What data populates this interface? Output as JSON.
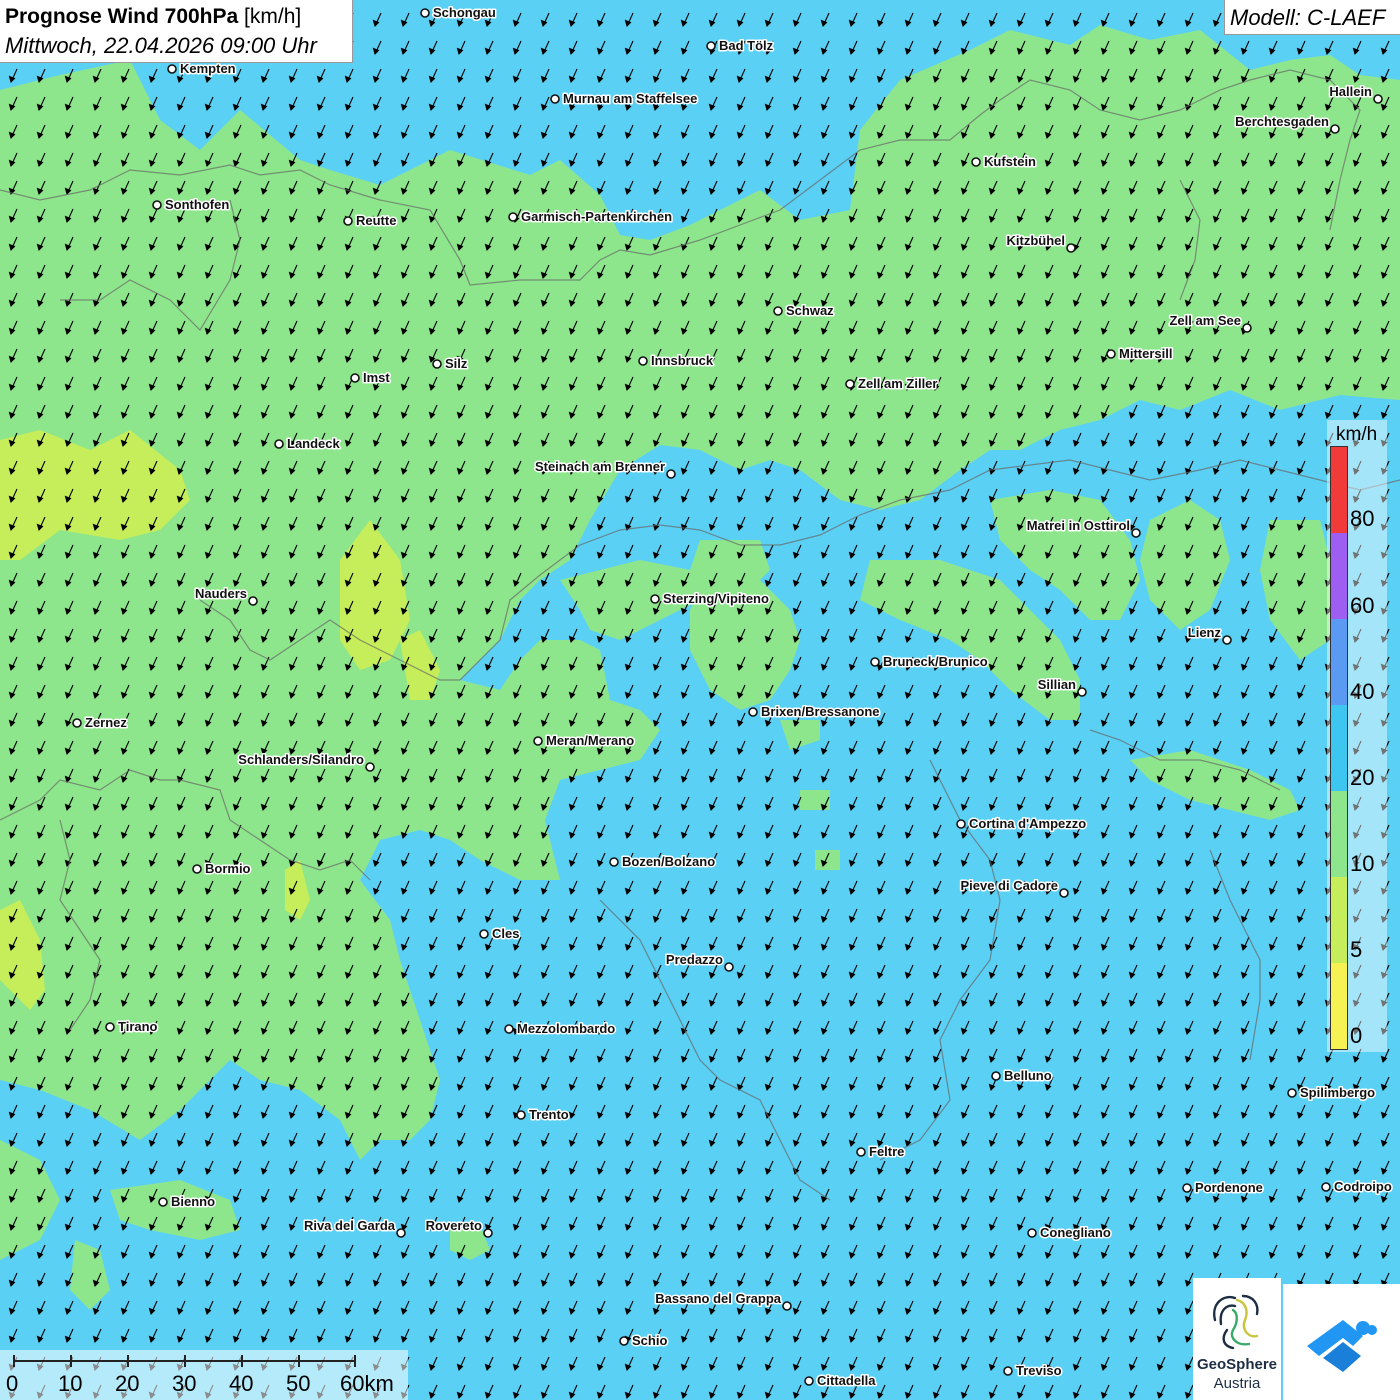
{
  "title": {
    "main": "Prognose Wind 700hPa",
    "unit": "[km/h]",
    "datetime": "Mittwoch, 22.04.2026 09:00 Uhr"
  },
  "model": "Modell: C-LAEF",
  "legend": {
    "unit": "km/h",
    "labels": [
      "80",
      "60",
      "40",
      "20",
      "10",
      "5",
      "0"
    ],
    "colors": {
      "c0_5": "#f7f253",
      "c5_10": "#c6ee5a",
      "c10_20": "#8ee68c",
      "c20_40": "#3cc6f0",
      "c40_60": "#5a9af3",
      "c60_80": "#9e5ef2",
      "c80": "#f13a3a"
    }
  },
  "scale_bar": {
    "labels": [
      "0",
      "10",
      "20",
      "30",
      "40",
      "50",
      "60km"
    ]
  },
  "logos": {
    "geosphere_line1": "GeoSphere",
    "geosphere_line2": "Austria"
  },
  "map": {
    "wind_direction": "northeast wind (arrows pointing south-southwest)",
    "cities": [
      {
        "name": "Schongau",
        "dot": "left"
      },
      {
        "name": "Bad Tölz",
        "dot": "left"
      },
      {
        "name": "Kempten",
        "dot": "left"
      },
      {
        "name": "Murnau am Staffelsee",
        "dot": "left"
      },
      {
        "name": "Hallein",
        "dot": "right"
      },
      {
        "name": "Berchtesgaden",
        "dot": "right"
      },
      {
        "name": "Kufstein",
        "dot": "left"
      },
      {
        "name": "Sonthofen",
        "dot": "left"
      },
      {
        "name": "Reutte",
        "dot": "left"
      },
      {
        "name": "Garmisch-Partenkirchen",
        "dot": "left"
      },
      {
        "name": "Kitzbühel",
        "dot": "right"
      },
      {
        "name": "Schwaz",
        "dot": "left"
      },
      {
        "name": "Zell am See",
        "dot": "right"
      },
      {
        "name": "Mittersill",
        "dot": "left"
      },
      {
        "name": "Innsbruck",
        "dot": "left"
      },
      {
        "name": "Silz",
        "dot": "left"
      },
      {
        "name": "Imst",
        "dot": "left"
      },
      {
        "name": "Zell am Ziller",
        "dot": "left"
      },
      {
        "name": "Landeck",
        "dot": "left"
      },
      {
        "name": "Steinach am Brenner",
        "dot": "right"
      },
      {
        "name": "Matrei in Osttirol",
        "dot": "right"
      },
      {
        "name": "Nauders",
        "dot": "right"
      },
      {
        "name": "Sterzing/Vipiteno",
        "dot": "left"
      },
      {
        "name": "Lienz",
        "dot": "right"
      },
      {
        "name": "Bruneck/Brunico",
        "dot": "left"
      },
      {
        "name": "Sillian",
        "dot": "right"
      },
      {
        "name": "Brixen/Bressanone",
        "dot": "left"
      },
      {
        "name": "Zernez",
        "dot": "left"
      },
      {
        "name": "Meran/Merano",
        "dot": "left"
      },
      {
        "name": "Schlanders/Silandro",
        "dot": "right"
      },
      {
        "name": "Cortina d'Ampezzo",
        "dot": "left"
      },
      {
        "name": "Bozen/Bolzano",
        "dot": "left"
      },
      {
        "name": "Bormio",
        "dot": "left"
      },
      {
        "name": "Pieve di Cadore",
        "dot": "right"
      },
      {
        "name": "Cles",
        "dot": "left"
      },
      {
        "name": "Predazzo",
        "dot": "right"
      },
      {
        "name": "Tirano",
        "dot": "left"
      },
      {
        "name": "Mezzolombardo",
        "dot": "left"
      },
      {
        "name": "Belluno",
        "dot": "left"
      },
      {
        "name": "Spilimbergo",
        "dot": "left"
      },
      {
        "name": "Trento",
        "dot": "left"
      },
      {
        "name": "Feltre",
        "dot": "left"
      },
      {
        "name": "Pordenone",
        "dot": "left"
      },
      {
        "name": "Codroipo",
        "dot": "left"
      },
      {
        "name": "Bienno",
        "dot": "left"
      },
      {
        "name": "Riva del Garda",
        "dot": "right"
      },
      {
        "name": "Rovereto",
        "dot": "right"
      },
      {
        "name": "Conegliano",
        "dot": "left"
      },
      {
        "name": "Bassano del Grappa",
        "dot": "right"
      },
      {
        "name": "Schio",
        "dot": "left"
      },
      {
        "name": "Treviso",
        "dot": "left"
      },
      {
        "name": "Cittadella",
        "dot": "left"
      }
    ]
  }
}
